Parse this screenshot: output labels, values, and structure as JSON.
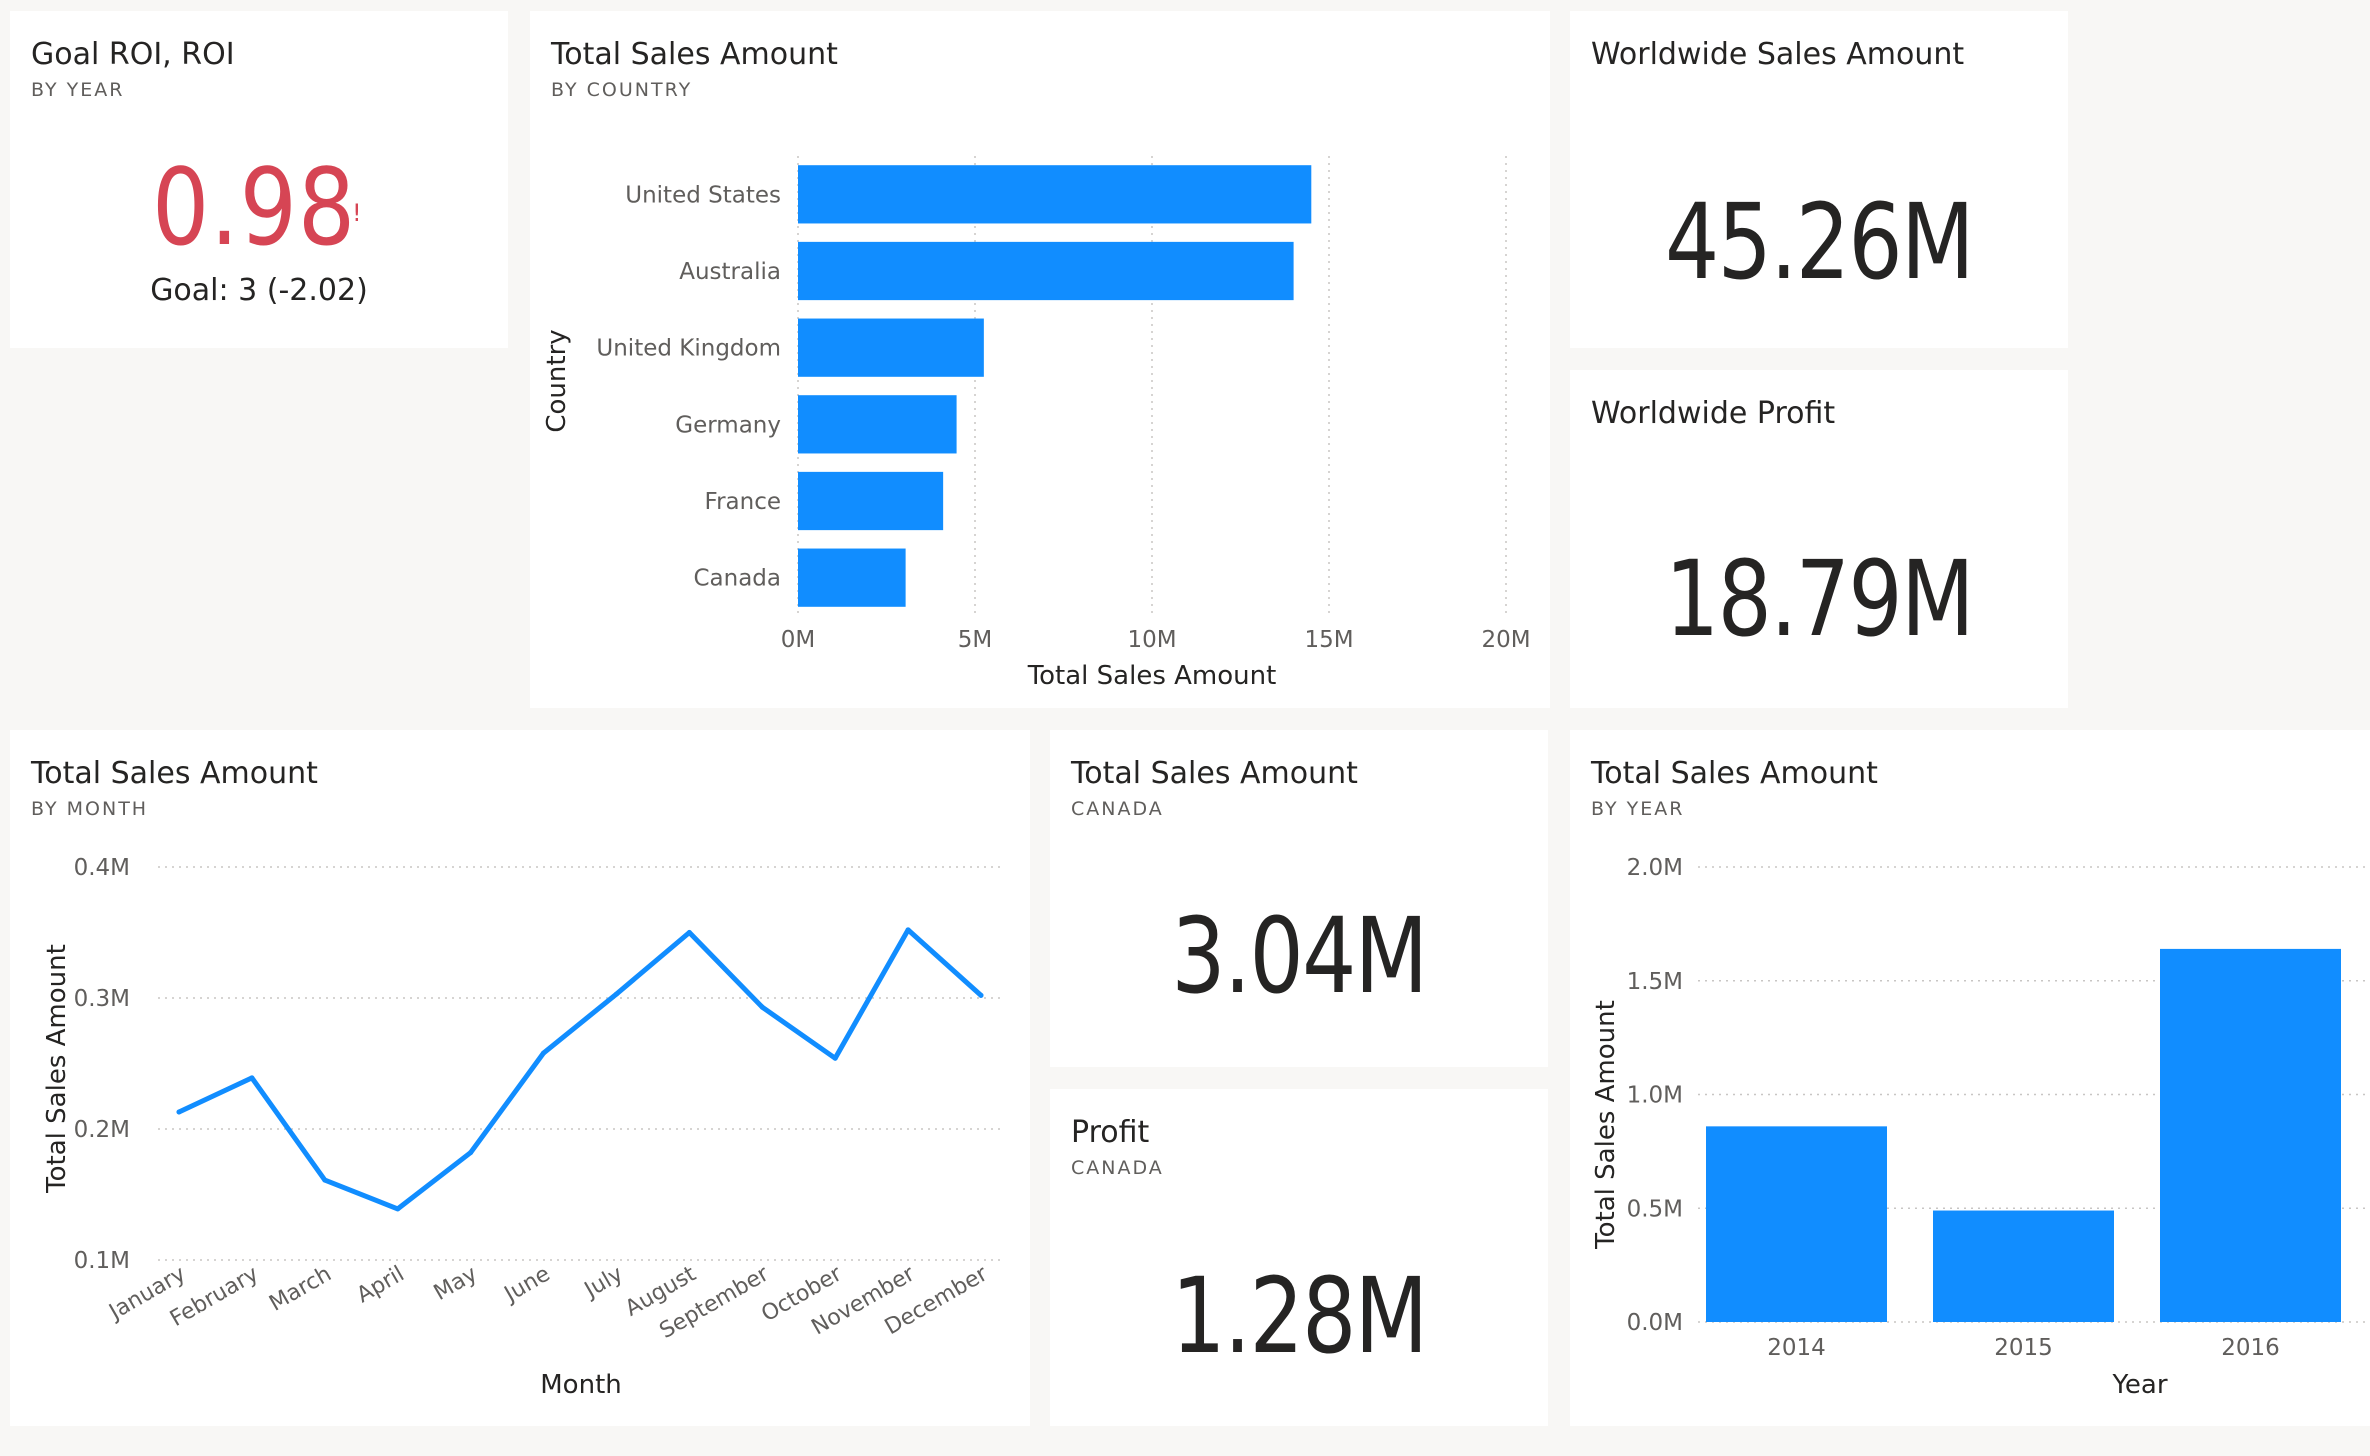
{
  "colors": {
    "accent": "#118DFF",
    "kpi_bad": "#D64554",
    "page_bg": "#F8F7F5",
    "tile_bg": "#FFFFFF",
    "grid": "#C8C6C4",
    "axis_text": "#605E5C"
  },
  "roi": {
    "title": "Goal ROI, ROI",
    "subtitle": "BY YEAR",
    "value": "0.98",
    "alert_glyph": "!",
    "goal_text": "Goal: 3 (-2.02)"
  },
  "country_chart": {
    "title": "Total Sales Amount",
    "subtitle": "BY COUNTRY"
  },
  "worldwide_sales": {
    "title": "Worldwide Sales Amount",
    "value": "45.26M"
  },
  "worldwide_profit": {
    "title": "Worldwide Profit",
    "value": "18.79M"
  },
  "month_chart": {
    "title": "Total Sales Amount",
    "subtitle": "BY MONTH"
  },
  "canada_sales": {
    "title": "Total Sales Amount",
    "subtitle": "CANADA",
    "value": "3.04M"
  },
  "canada_profit": {
    "title": "Profit",
    "subtitle": "CANADA",
    "value": "1.28M"
  },
  "year_chart": {
    "title": "Total Sales Amount",
    "subtitle": "BY YEAR"
  },
  "chart_data": [
    {
      "id": "by_country",
      "type": "bar",
      "orientation": "horizontal",
      "categories": [
        "United States",
        "Australia",
        "United Kingdom",
        "Germany",
        "France",
        "Canada"
      ],
      "values": [
        14.5,
        14.0,
        5.25,
        4.48,
        4.1,
        3.04
      ],
      "value_unit": "M",
      "xlabel": "Total Sales Amount",
      "ylabel": "Country",
      "xlim": [
        0,
        20
      ],
      "x_ticks": [
        "0M",
        "5M",
        "10M",
        "15M",
        "20M"
      ],
      "grid": true
    },
    {
      "id": "by_month",
      "type": "line",
      "categories": [
        "January",
        "February",
        "March",
        "April",
        "May",
        "June",
        "July",
        "August",
        "September",
        "October",
        "November",
        "December"
      ],
      "values": [
        0.213,
        0.239,
        0.161,
        0.139,
        0.182,
        0.258,
        0.303,
        0.35,
        0.293,
        0.254,
        0.352,
        0.302
      ],
      "value_unit": "M",
      "xlabel": "Month",
      "ylabel": "Total Sales Amount",
      "ylim": [
        0.1,
        0.4
      ],
      "y_ticks": [
        "0.1M",
        "0.2M",
        "0.3M",
        "0.4M"
      ],
      "grid": true
    },
    {
      "id": "by_year",
      "type": "bar",
      "orientation": "vertical",
      "categories": [
        "2014",
        "2015",
        "2016"
      ],
      "values": [
        0.86,
        0.49,
        1.64
      ],
      "value_unit": "M",
      "xlabel": "Year",
      "ylabel": "Total Sales Amount",
      "ylim": [
        0,
        2.0
      ],
      "y_ticks": [
        "0.0M",
        "0.5M",
        "1.0M",
        "1.5M",
        "2.0M"
      ],
      "grid": true
    }
  ]
}
